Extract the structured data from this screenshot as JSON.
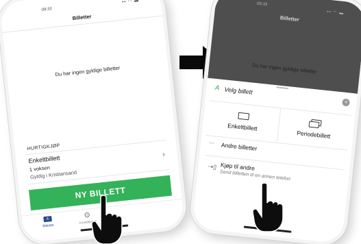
{
  "left_screen": {
    "status_time": "09:33",
    "status_icons": "▪▪ ◠ ▬",
    "header_title": "Billetter",
    "empty_message": "Du har ingen gyldige billetter",
    "quick_buy": {
      "heading": "HURTIGKJØP",
      "ticket_title": "Enkeltbillett",
      "passenger": "1 voksen",
      "validity": "Gyldig i Kristiansand",
      "chevron": "›"
    },
    "new_ticket_button": "NY BILLETT",
    "bottom_nav": [
      {
        "label": "Billetter",
        "icon": "ticket-icon",
        "glyph": "A"
      },
      {
        "label": "Innstillinger",
        "icon": "gear-icon",
        "glyph": "⚙"
      }
    ]
  },
  "right_screen": {
    "status_time": "09:33",
    "status_icons": "▪▪ ◠ ▬",
    "header_title": "Billetter",
    "empty_message": "Du har ingen gyldige billetter",
    "sheet": {
      "logo_glyph": "A",
      "title": "Velg billett",
      "close_glyph": "×",
      "options": [
        {
          "label": "Enkeltbillett",
          "icon": "single-ticket-icon"
        },
        {
          "label": "Periodebillett",
          "icon": "period-ticket-icon"
        }
      ],
      "other_dots": "···",
      "other_label": "Andre billetter",
      "buy_for_others": {
        "glyph": "⇢▯",
        "label": "Kjøp til andre",
        "sub": "Send billetten til en annen telefon"
      }
    }
  },
  "colors": {
    "accent_green": "#34b25a",
    "nav_blue": "#2c4b94",
    "overlay_dark": "#4e4e4e"
  }
}
